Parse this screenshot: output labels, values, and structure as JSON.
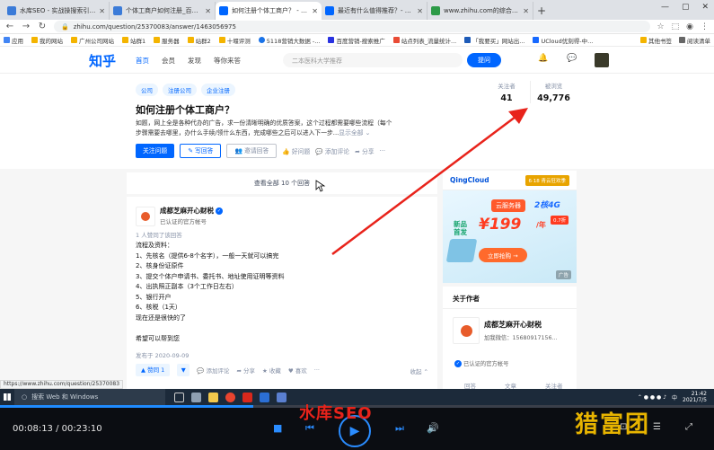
{
  "browser": {
    "tabs": [
      {
        "title": "水库SEO - 实战操搜索引擎营销",
        "color": "#3b7bd8",
        "active": false
      },
      {
        "title": "个体工商户如何注册_百度搜索",
        "color": "#3b7bd8",
        "active": false
      },
      {
        "title": "如何注册个体工商户？ - 知乎",
        "color": "#0066ff",
        "active": true
      },
      {
        "title": "最近有什么值得推荐？- 知乎",
        "color": "#0066ff",
        "active": false
      },
      {
        "title": "www.zhihu.com的综合查询_4G",
        "color": "#2d9b48",
        "active": false
      }
    ],
    "new_tab": "+",
    "window_controls": [
      "—",
      "▢",
      "✕"
    ],
    "url": "zhihu.com/question/25370083/answer/1463056975",
    "bookmarks": [
      "应用",
      "我的网站",
      "广州公司网站",
      "站群1",
      "服务器",
      "站群2",
      "十堰评测",
      "5118营销大数据 -...",
      "百度营销-搜索推广",
      "站点列表_流量统计...",
      "「我要买」网站出...",
      "UCloud优刻得-中...",
      "其他书签",
      "阅读清单"
    ]
  },
  "zhihu": {
    "logo": "知乎",
    "nav": [
      "首页",
      "会员",
      "发现",
      "等你来答"
    ],
    "search_placeholder": "二本医科大学推荐",
    "ask_button": "提问",
    "question": {
      "topics": [
        "公司",
        "注册公司",
        "企业注册"
      ],
      "title": "如何注册个体工商户？",
      "desc": "如题，网上全是各种代办的广告，求一份清晰明确的优质答案，这个过程都需要哪些流程（每个步骤需要去哪里，办什么手续/领什么东西，完成哪些之后可以进入下一步...",
      "desc_more": "显示全部 ⌄",
      "follow_button": "关注问题",
      "write_button": "写回答",
      "invite_button": "邀请回答",
      "good_q": "好问题",
      "comment": "添加评论",
      "share": "分享",
      "more": "···",
      "followers_label": "关注者",
      "followers": "41",
      "views_label": "被浏览",
      "views": "49,776"
    },
    "view_all": "查看全部 10 个回答",
    "answer": {
      "author": "成都芝麻开心财税",
      "author_sub": "已认证的官方帐号",
      "agree_note": "1 人赞同了该回答",
      "lines": [
        "流程及资料：",
        "1、先核名（提供6-8个名字），一般一天就可以搞完",
        "2、核身份证原件",
        "3、提交个体户申请书、委托书、地址使用证明等资料",
        "4、出执照正副本（3个工作日左右）",
        "5、银行开户",
        "6、核税（1天）",
        "现在还是很快的了",
        "",
        "希望可以帮到您"
      ],
      "pubdate": "发布于 2020-09-09",
      "upvote": "▲ 赞同 1",
      "downvote": "▼",
      "comment": "添加评论",
      "share": "分享",
      "collect": "收藏",
      "like": "喜欢",
      "collapse": "收起 ⌃"
    },
    "ad": {
      "brand": "QingCloud",
      "badge": "6·18 青云狂欢季",
      "tag": "云服务器",
      "spec": "2核4G",
      "new_label": "新品首发",
      "price": "¥199",
      "unit": "/年",
      "discount": "0.7折",
      "cta": "立即抢购 →",
      "mark": "广告"
    },
    "about": {
      "title": "关于作者",
      "name": "成都芝麻开心财税",
      "sub": "加我微信：15680917156...",
      "verified": "已认证的官方帐号",
      "tabs": [
        "回答",
        "文章",
        "关注者"
      ]
    }
  },
  "status_url": "https://www.zhihu.com/question/25370083",
  "taskbar": {
    "search": "搜索 Web 和 Windows",
    "time": "21:42",
    "date": "2021/7/5",
    "ime": "中"
  },
  "player": {
    "time": "00:08:13 / 00:23:10",
    "progress": 0.355,
    "brand": "水库SEO",
    "watermark": "猎富团"
  }
}
